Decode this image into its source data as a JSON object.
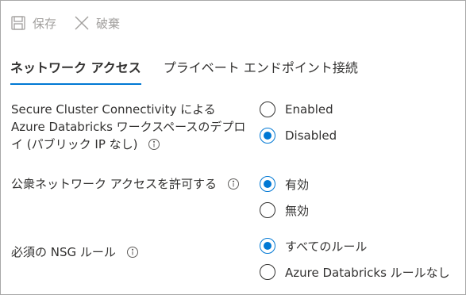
{
  "toolbar": {
    "save_label": "保存",
    "discard_label": "破棄"
  },
  "tabs": [
    {
      "label": "ネットワーク アクセス",
      "active": true
    },
    {
      "label": "プライベート エンドポイント接続",
      "active": false
    }
  ],
  "fields": [
    {
      "label": "Secure Cluster Connectivity による Azure Databricks ワークスペースのデプロイ (パブリック IP なし)",
      "options": [
        {
          "label": "Enabled",
          "selected": false
        },
        {
          "label": "Disabled",
          "selected": true
        }
      ]
    },
    {
      "label": "公衆ネットワーク アクセスを許可する",
      "options": [
        {
          "label": "有効",
          "selected": true
        },
        {
          "label": "無効",
          "selected": false
        }
      ]
    },
    {
      "label": "必須の NSG ルール",
      "options": [
        {
          "label": "すべてのルール",
          "selected": true
        },
        {
          "label": "Azure Databricks ルールなし",
          "selected": false
        }
      ]
    }
  ],
  "colors": {
    "accent": "#0078d4",
    "disabled_text": "#a19f9d",
    "text": "#323130"
  }
}
